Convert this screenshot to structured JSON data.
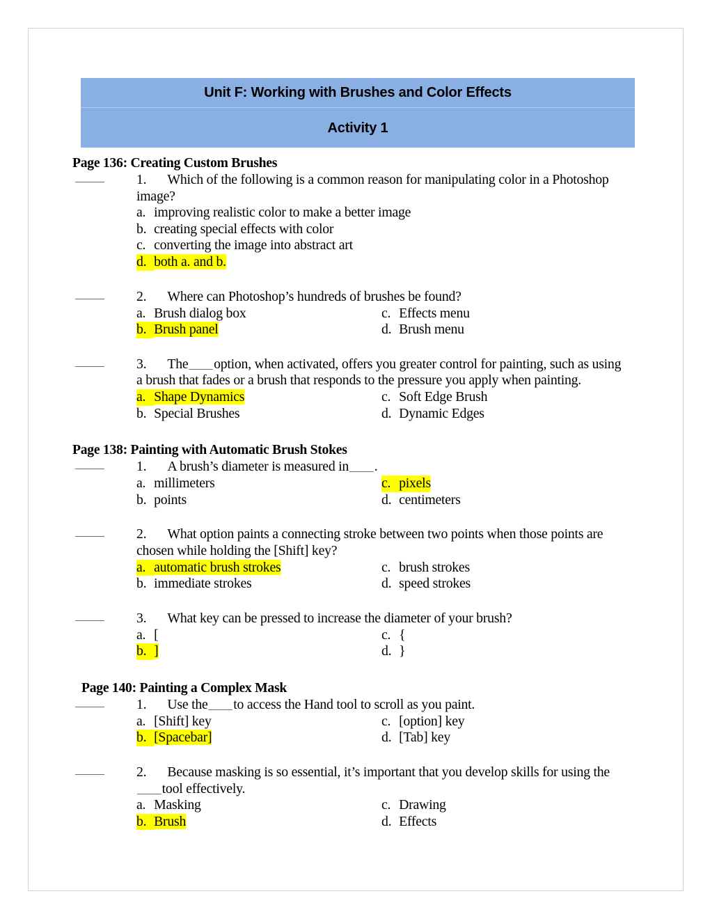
{
  "document": {
    "header": {
      "title": "Unit F: Working with Brushes and Color Effects",
      "subtitle": "Activity 1",
      "background_color": "#8ab0e3"
    },
    "highlight_color": "#ffff00",
    "sections": [
      {
        "heading": "Page 136: Creating Custom Brushes",
        "questions": [
          {
            "number": "1.",
            "stem_part1": "Which of the following is a common reason for manipulating color in a Photoshop image?",
            "options": [
              {
                "letter": "a.",
                "text": "improving realistic color to make a better image"
              },
              {
                "letter": "b.",
                "text": "creating special effects with color"
              },
              {
                "letter": "c.",
                "text": "converting the image into abstract art"
              },
              {
                "letter": "d.",
                "text": "both a. and b."
              }
            ]
          },
          {
            "number": "2.",
            "stem_part1": "Where can Photoshop’s hundreds of brushes be found?",
            "options": [
              {
                "letter": "a.",
                "text": "Brush dialog box"
              },
              {
                "letter": "b.",
                "text": "Brush panel"
              },
              {
                "letter": "c.",
                "text": "Effects menu"
              },
              {
                "letter": "d.",
                "text": "Brush menu"
              }
            ]
          },
          {
            "number": "3.",
            "stem_part1": "The",
            "stem_part2": "option, when activated, offers you greater control for painting, such as using a brush that fades or a brush that responds to the pressure you apply when painting.",
            "options": [
              {
                "letter": "a.",
                "text": "Shape Dynamics"
              },
              {
                "letter": "b.",
                "text": "Special Brushes"
              },
              {
                "letter": "c.",
                "text": "Soft Edge Brush"
              },
              {
                "letter": "d.",
                "text": "Dynamic Edges"
              }
            ]
          }
        ]
      },
      {
        "heading": "Page 138: Painting with Automatic Brush Stokes",
        "questions": [
          {
            "number": "1.",
            "stem_part1": "A brush’s diameter is measured in",
            "stem_part2": ".",
            "options": [
              {
                "letter": "a.",
                "text": "millimeters"
              },
              {
                "letter": "b.",
                "text": "points"
              },
              {
                "letter": "c.",
                "text": "pixels"
              },
              {
                "letter": "d.",
                "text": "centimeters"
              }
            ]
          },
          {
            "number": "2.",
            "stem_part1": "What option paints a connecting stroke between two points when those points are chosen while holding the [Shift] key?",
            "options": [
              {
                "letter": "a.",
                "text": "automatic brush strokes"
              },
              {
                "letter": "b.",
                "text": "immediate strokes"
              },
              {
                "letter": "c.",
                "text": "brush strokes"
              },
              {
                "letter": "d.",
                "text": "speed strokes"
              }
            ]
          },
          {
            "number": "3.",
            "stem_part1": "What key can be pressed to increase the diameter of your brush?",
            "options": [
              {
                "letter": "a.",
                "text": "["
              },
              {
                "letter": "b.",
                "text": "]"
              },
              {
                "letter": "c.",
                "text": "{"
              },
              {
                "letter": "d.",
                "text": "}"
              }
            ]
          }
        ]
      },
      {
        "heading": "Page 140: Painting a Complex Mask",
        "questions": [
          {
            "number": "1.",
            "stem_part1": "Use the",
            "stem_part2": "to access the Hand tool to scroll as you paint.",
            "options": [
              {
                "letter": "a.",
                "text": "[Shift] key"
              },
              {
                "letter": "b.",
                "text": "[Spacebar]"
              },
              {
                "letter": "c.",
                "text": "[option] key"
              },
              {
                "letter": "d.",
                "text": "[Tab] key"
              }
            ]
          },
          {
            "number": "2.",
            "stem_part1": "Because masking is so essential, it’s important that you develop skills for using the",
            "stem_part2": "tool effectively.",
            "options": [
              {
                "letter": "a.",
                "text": "Masking"
              },
              {
                "letter": "b.",
                "text": "Brush"
              },
              {
                "letter": "c.",
                "text": "Drawing"
              },
              {
                "letter": "d.",
                "text": "Effects"
              }
            ]
          }
        ]
      }
    ]
  }
}
